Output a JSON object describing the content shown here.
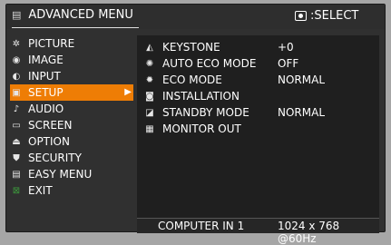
{
  "header": {
    "title": "ADVANCED MENU",
    "select_label": "SELECT"
  },
  "sidebar": {
    "items": [
      {
        "label": "PICTURE",
        "icon": "picture-icon",
        "glyph": "✲"
      },
      {
        "label": "IMAGE",
        "icon": "image-icon",
        "glyph": "◉"
      },
      {
        "label": "INPUT",
        "icon": "input-icon",
        "glyph": "◐"
      },
      {
        "label": "SETUP",
        "icon": "setup-icon",
        "glyph": "▣"
      },
      {
        "label": "AUDIO",
        "icon": "audio-icon",
        "glyph": "♪"
      },
      {
        "label": "SCREEN",
        "icon": "screen-icon",
        "glyph": "▭"
      },
      {
        "label": "OPTION",
        "icon": "option-icon",
        "glyph": "⏏"
      },
      {
        "label": "SECURITY",
        "icon": "security-icon",
        "glyph": "⛊"
      },
      {
        "label": "EASY MENU",
        "icon": "easy-menu-icon",
        "glyph": "▤"
      },
      {
        "label": "EXIT",
        "icon": "exit-icon",
        "glyph": "⊠"
      }
    ],
    "selected": "SETUP",
    "accent_color": "#ee7d05"
  },
  "setup_panel": {
    "rows": [
      {
        "label": "KEYSTONE",
        "value": "+0",
        "icon": "keystone-icon",
        "glyph": "◭"
      },
      {
        "label": "AUTO ECO MODE",
        "value": "OFF",
        "icon": "auto-eco-mode-icon",
        "glyph": "✺"
      },
      {
        "label": "ECO MODE",
        "value": "NORMAL",
        "icon": "eco-mode-icon",
        "glyph": "✹"
      },
      {
        "label": "INSTALLATION",
        "value": "",
        "icon": "installation-icon",
        "glyph": "◙"
      },
      {
        "label": "STANDBY MODE",
        "value": "NORMAL",
        "icon": "standby-mode-icon",
        "glyph": "◪"
      },
      {
        "label": "MONITOR OUT",
        "value": "",
        "icon": "monitor-out-icon",
        "glyph": "▦"
      }
    ]
  },
  "status": {
    "source": "COMPUTER IN 1",
    "resolution": "1024 x 768 @60Hz"
  }
}
